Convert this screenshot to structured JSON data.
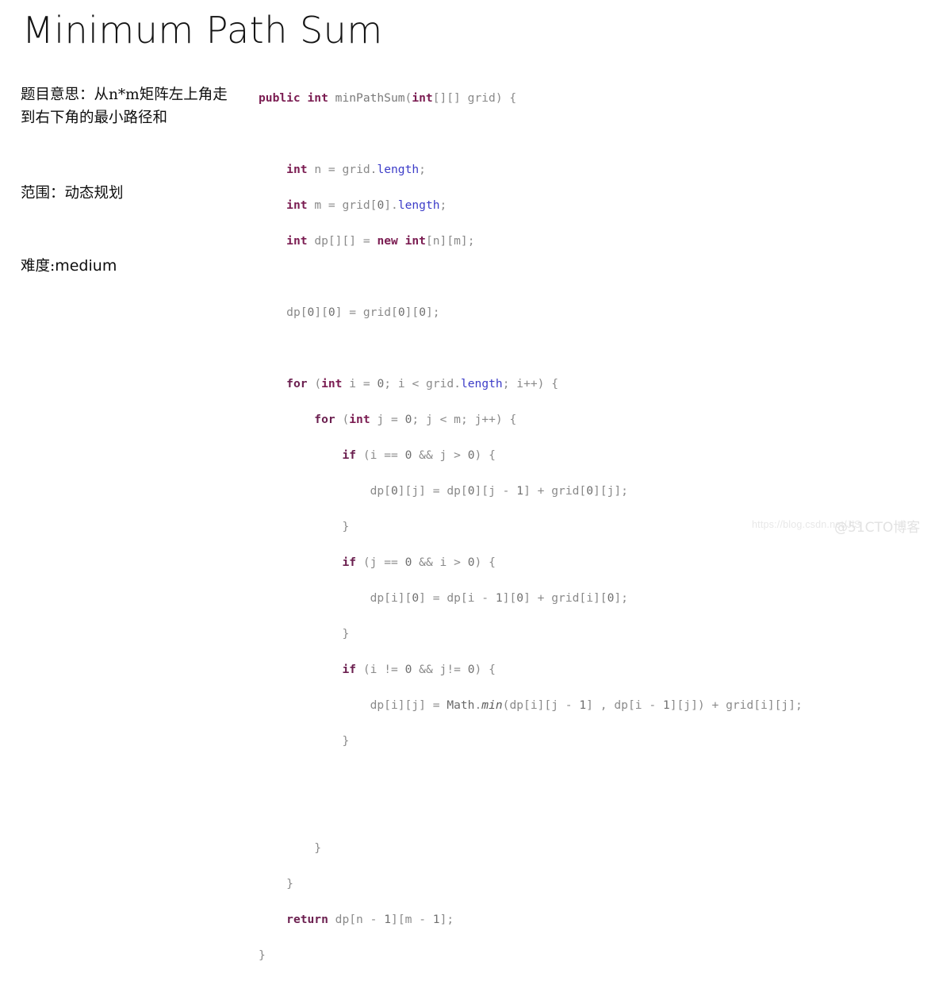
{
  "slide": {
    "title": "Minimum Path Sum",
    "notes": {
      "description": "题目意思：从n*m矩阵左上角走到右下角的最小路径和",
      "scope": "范围：动态规划",
      "difficulty_label": "难度:",
      "difficulty_value": "medium"
    },
    "code": {
      "language": "java",
      "lines": [
        "public int minPathSum(int[][] grid) {",
        "",
        "    int n = grid.length;",
        "    int m = grid[0].length;",
        "    int dp[][] = new int[n][m];",
        "",
        "    dp[0][0] = grid[0][0];",
        "",
        "    for (int i = 0; i < grid.length; i++) {",
        "        for (int j = 0; j < m; j++) {",
        "            if (i == 0 && j > 0) {",
        "                dp[0][j] = dp[0][j - 1] + grid[0][j];",
        "            }",
        "            if (j == 0 && i > 0) {",
        "                dp[i][0] = dp[i - 1][0] + grid[i][0];",
        "            }",
        "            if (i != 0 && j!= 0) {",
        "                dp[i][j] = Math.min(dp[i][j - 1] , dp[i - 1][j]) + grid[i][j];",
        "            }",
        "",
        "",
        "        }",
        "    }",
        "    return dp[n - 1][m - 1];",
        "}"
      ]
    },
    "watermarks": {
      "csdn": "https://blog.csdn.net/JiS",
      "cto": "@51CTO博客"
    },
    "colors": {
      "background": "#ffffff",
      "title_text": "#141414",
      "note_text": "#0d0d0d",
      "code_default": "#7a7a7a",
      "code_keyword": "#7b1d52",
      "code_field": "#3c3cc8",
      "watermark": "#e6e6e6"
    }
  }
}
